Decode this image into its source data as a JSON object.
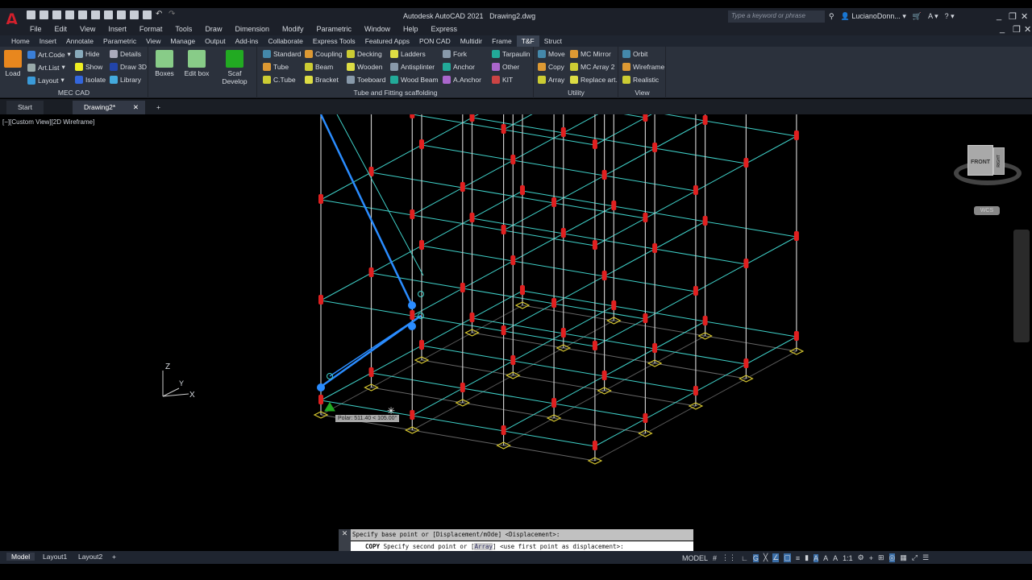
{
  "app": {
    "title": "Autodesk AutoCAD 2021",
    "file": "Drawing2.dwg",
    "search_placeholder": "Type a keyword or phrase",
    "user": "LucianoDonn...",
    "logo": "A"
  },
  "menu": [
    "File",
    "Edit",
    "View",
    "Insert",
    "Format",
    "Tools",
    "Draw",
    "Dimension",
    "Modify",
    "Parametric",
    "Window",
    "Help",
    "Express"
  ],
  "ribbon_tabs": [
    "Home",
    "Insert",
    "Annotate",
    "Parametric",
    "View",
    "Manage",
    "Output",
    "Add-ins",
    "Collaborate",
    "Express Tools",
    "Featured Apps",
    "PON CAD",
    "Multidir",
    "Frame",
    "T&F",
    "Struct"
  ],
  "active_tab": "T&F",
  "panels": {
    "mec": {
      "title": "MEC CAD",
      "load": "Load",
      "col1": [
        "Art.Code",
        "Art.List",
        "Layout"
      ],
      "col2": [
        "Hide",
        "Show",
        "Isolate"
      ],
      "col3": [
        "Details",
        "Draw 3D",
        "Library"
      ]
    },
    "boxes": {
      "items": [
        "Boxes",
        "Edit box",
        "Scaf Develop"
      ]
    },
    "tube": {
      "title": "Tube and Fitting scaffolding",
      "col1": [
        "Standard",
        "Tube",
        "C.Tube"
      ],
      "col2": [
        "Coupling",
        "Beam",
        "Bracket"
      ],
      "col3": [
        "Decking",
        "Wooden",
        "Toeboard"
      ],
      "col4": [
        "Ladders",
        "Antisplinter",
        "Wood Beam"
      ],
      "col5": [
        "Fork",
        "Anchor",
        "A.Anchor"
      ],
      "col6": [
        "Tarpaulin",
        "Other",
        "KIT"
      ]
    },
    "utility": {
      "title": "Utility",
      "col1": [
        "Move",
        "Copy",
        "Array"
      ],
      "col2": [
        "MC Mirror",
        "MC Array 2",
        "Replace art."
      ]
    },
    "view": {
      "title": "View",
      "col1": [
        "Orbit",
        "Wireframe",
        "Realistic"
      ]
    }
  },
  "doc_tabs": [
    "Start",
    "Drawing2*"
  ],
  "viewport": {
    "label": "[−][Custom View][2D Wireframe]",
    "tooltip": "Polar: 511.40 < 105.00°",
    "viewcube": "FRONT",
    "viewcube_side": "RIGHT",
    "wcs": "WCS",
    "ucs": {
      "z": "Z",
      "y": "Y",
      "x": "X"
    }
  },
  "command": {
    "history": "Specify base point or [Displacement/mOde] <Displacement>:",
    "command": "COPY",
    "prompt": "Specify second point or [",
    "option": "Array",
    "prompt_end": "] <use first point as displacement>:"
  },
  "layouts": [
    "Model",
    "Layout1",
    "Layout2"
  ],
  "status": {
    "model": "MODEL",
    "scale": "1:1"
  },
  "colors": {
    "post": "#c8c8c8",
    "ledger": "#3fd0c8",
    "clamp": "#e02020",
    "base": "#d8c830",
    "selected": "#2a8cff"
  }
}
